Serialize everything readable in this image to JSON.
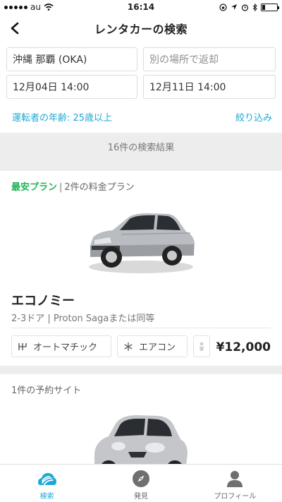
{
  "status_bar": {
    "carrier": "au",
    "time": "16:14"
  },
  "header": {
    "title": "レンタカーの検索"
  },
  "search": {
    "pickup_location": "沖縄 那覇 (OKA)",
    "return_location_placeholder": "別の場所で返却",
    "pickup_datetime": "12月04日 14:00",
    "return_datetime": "12月11日 14:00",
    "driver_age": "運転者の年齢: 25歳以上",
    "filter_label": "絞り込み"
  },
  "results": {
    "count_text": "16件の検索結果"
  },
  "cards": [
    {
      "badge": "最安プラン",
      "plans": "2件の料金プラン",
      "name": "エコノミー",
      "desc": "2-3ドア | Proton Sagaまたは同等",
      "transmission": "オートマチック",
      "aircon": "エアコン",
      "price": "¥12,000"
    },
    {
      "plans": "1件の予約サイト"
    }
  ],
  "tab_bar": {
    "tabs": [
      {
        "label": "検索",
        "icon": "cloud-wave-icon"
      },
      {
        "label": "発見",
        "icon": "compass-icon"
      },
      {
        "label": "プロフィール",
        "icon": "person-icon"
      }
    ]
  },
  "colors": {
    "accent": "#1da8d6",
    "cheap_badge": "#22b35a",
    "background": "#ededed"
  }
}
